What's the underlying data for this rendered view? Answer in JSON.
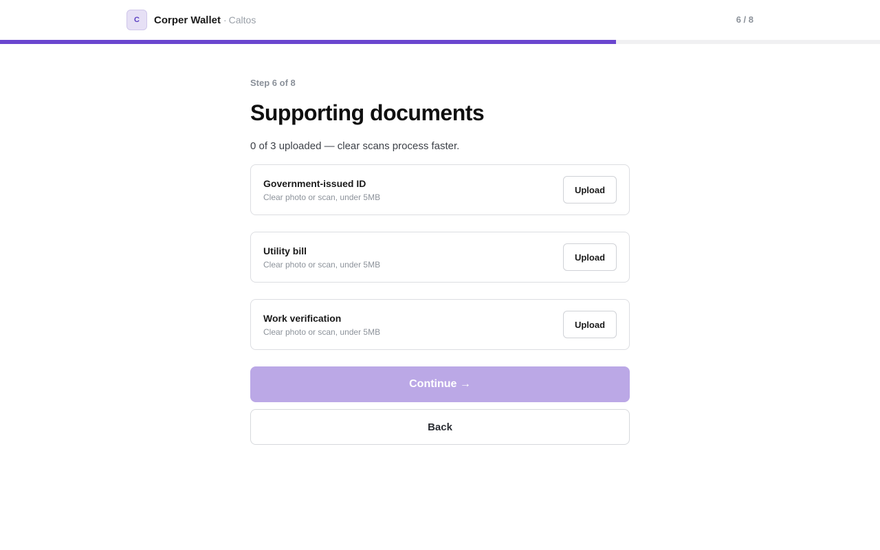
{
  "header": {
    "avatar_letter": "C",
    "app_name": "Corper Wallet",
    "separator": "·",
    "org_name": "Caltos",
    "step_count": "6 / 8"
  },
  "progress": {
    "current_step": 6,
    "total_steps": 8,
    "fraction": 0.7,
    "color": "#6a46cf"
  },
  "main": {
    "eyebrow": "Step 6 of 8",
    "title": "Supporting documents",
    "subtitle": "0 of 3 uploaded — clear scans process faster.",
    "documents": [
      {
        "name": "Government-issued ID",
        "hint": "Clear photo or scan, under 5MB",
        "action_label": "Upload"
      },
      {
        "name": "Utility bill",
        "hint": "Clear photo or scan, under 5MB",
        "action_label": "Upload"
      },
      {
        "name": "Work verification",
        "hint": "Clear photo or scan, under 5MB",
        "action_label": "Upload"
      }
    ],
    "continue_label": "Continue →",
    "back_label": "Back"
  },
  "colors": {
    "accent": "#6a46cf",
    "continue_disabled": "#bba8e6"
  }
}
